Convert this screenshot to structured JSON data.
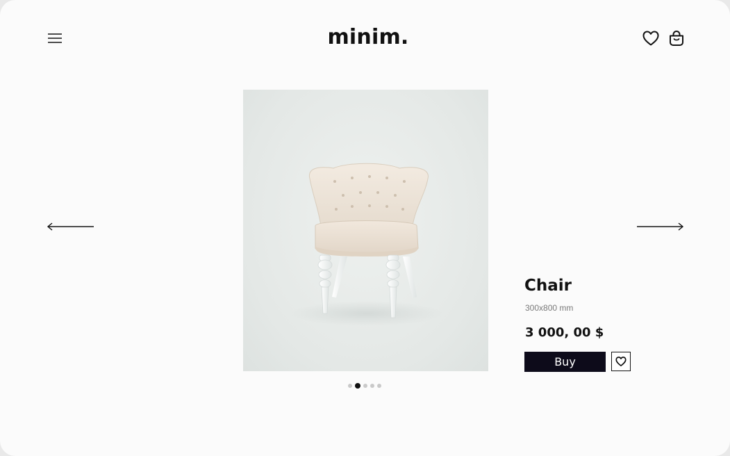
{
  "header": {
    "logo": "minim.",
    "icons": {
      "menu": "hamburger-menu-icon",
      "wishlist": "heart-icon",
      "cart": "shopping-bag-icon"
    }
  },
  "carousel": {
    "prev_icon": "arrow-left-icon",
    "next_icon": "arrow-right-icon",
    "slide_count": 5,
    "active_slide": 2
  },
  "product": {
    "name": "Chair",
    "dimensions": "300x800 mm",
    "price": "3 000, 00 $",
    "buy_label": "Buy",
    "favorite_icon": "heart-icon"
  },
  "colors": {
    "background": "#fbfbfb",
    "button": "#0d0b1a",
    "text": "#111111",
    "muted": "#7a7a7a"
  }
}
